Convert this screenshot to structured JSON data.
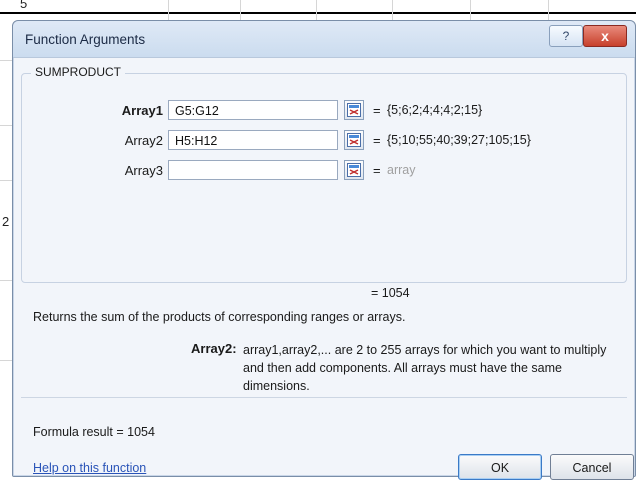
{
  "sheet": {
    "cell_top": "5",
    "cell_left": "2"
  },
  "dialog": {
    "title": "Function Arguments",
    "help_button": "?",
    "close_button": "x",
    "function_name": "SUMPRODUCT",
    "arguments": [
      {
        "label": "Array1",
        "value": "G5:G12",
        "result": "{5;6;2;4;4;4;2;15}",
        "bold": true
      },
      {
        "label": "Array2",
        "value": "H5:H12",
        "result": "{5;10;55;40;39;27;105;15}",
        "bold": false
      },
      {
        "label": "Array3",
        "value": "",
        "result": "array",
        "bold": false
      }
    ],
    "equals_sign": "=",
    "function_result": "= 1054",
    "description": "Returns the sum of the products of corresponding ranges or arrays.",
    "arg_help_name": "Array2:",
    "arg_help_text": "array1,array2,... are 2 to 255 arrays for which you want to multiply and then add components. All arrays must have the same dimensions.",
    "formula_result": "Formula result =   1054",
    "help_link": "Help on this function",
    "ok_label": "OK",
    "cancel_label": "Cancel"
  },
  "colors": {
    "dialog_bg": "#f2f5fa",
    "title_bar": "#cbdcef",
    "close_button": "#c7402c",
    "link": "#2a54b8"
  }
}
